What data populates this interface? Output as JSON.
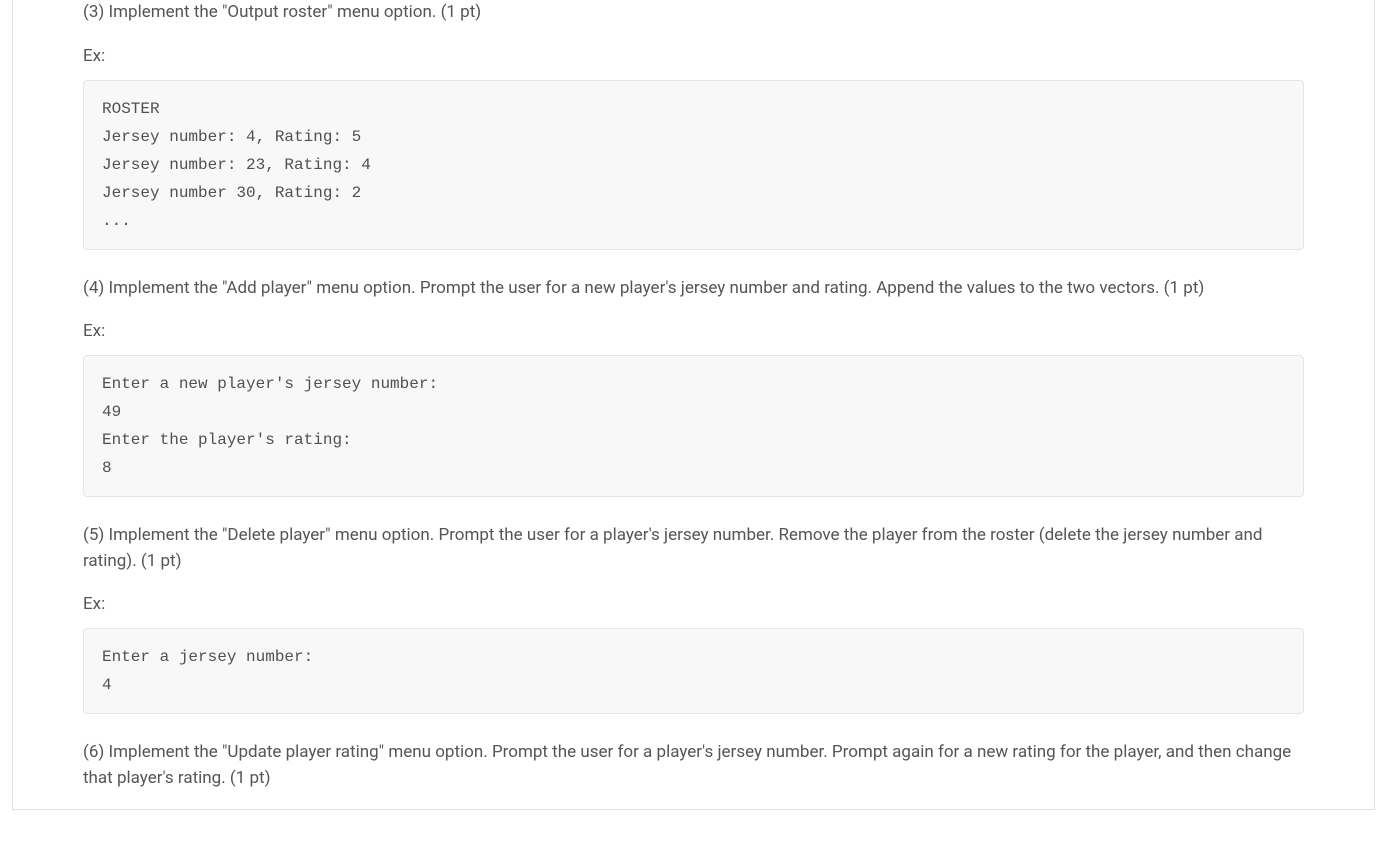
{
  "sections": {
    "s3": {
      "instruction": "(3) Implement the \"Output roster\" menu option. (1 pt)",
      "ex_label": "Ex:",
      "code": "ROSTER\nJersey number: 4, Rating: 5\nJersey number: 23, Rating: 4\nJersey number 30, Rating: 2\n..."
    },
    "s4": {
      "instruction": "(4) Implement the \"Add player\" menu option. Prompt the user for a new player's jersey number and rating. Append the values to the two vectors. (1 pt)",
      "ex_label": "Ex:",
      "code": "Enter a new player's jersey number:\n49\nEnter the player's rating:\n8"
    },
    "s5": {
      "instruction": "(5) Implement the \"Delete player\" menu option. Prompt the user for a player's jersey number. Remove the player from the roster (delete the jersey number and rating). (1 pt)",
      "ex_label": "Ex:",
      "code": "Enter a jersey number:\n4"
    },
    "s6": {
      "instruction": "(6) Implement the \"Update player rating\" menu option. Prompt the user for a player's jersey number. Prompt again for a new rating for the player, and then change that player's rating. (1 pt)"
    }
  }
}
